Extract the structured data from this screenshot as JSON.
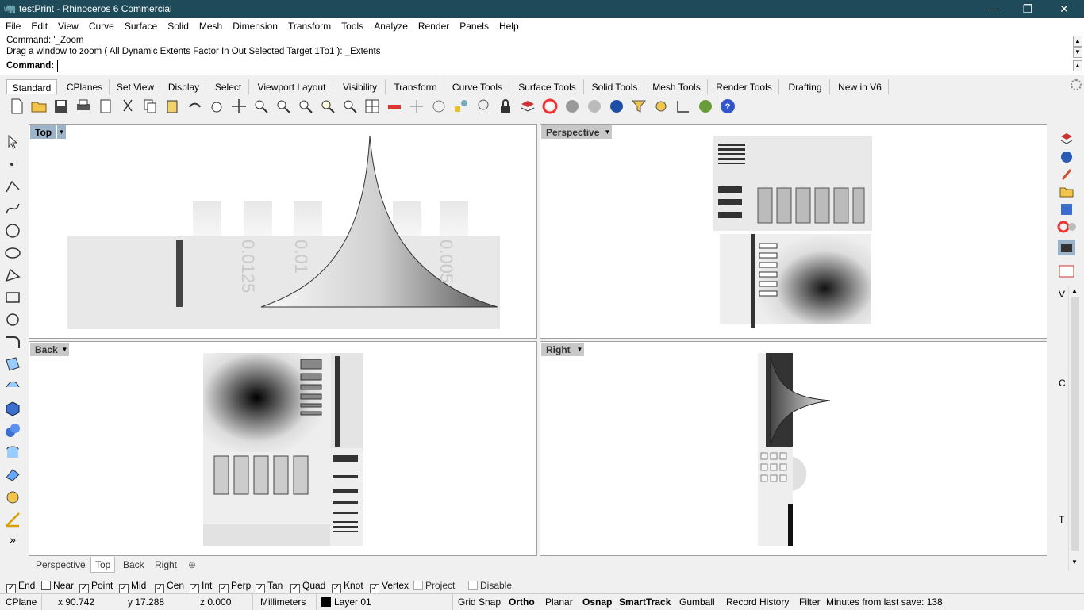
{
  "window": {
    "title": "testPrint - Rhinoceros 6 Commercial",
    "minimize": "—",
    "maximize": "❐",
    "close": "✕"
  },
  "menu": [
    "File",
    "Edit",
    "View",
    "Curve",
    "Surface",
    "Solid",
    "Mesh",
    "Dimension",
    "Transform",
    "Tools",
    "Analyze",
    "Render",
    "Panels",
    "Help"
  ],
  "command": {
    "history1": "Command: '_Zoom",
    "history2": "Drag a window to zoom ( All  Dynamic  Extents  Factor  In  Out  Selected  Target  1To1 ): _Extents",
    "label": "Command:",
    "value": ""
  },
  "toolbar_tabs": [
    "Standard",
    "CPlanes",
    "Set View",
    "Display",
    "Select",
    "Viewport Layout",
    "Visibility",
    "Transform",
    "Curve Tools",
    "Surface Tools",
    "Solid Tools",
    "Mesh Tools",
    "Render Tools",
    "Drafting",
    "New in V6"
  ],
  "viewports": {
    "top": "Top",
    "perspective": "Perspective",
    "back": "Back",
    "right": "Right"
  },
  "top_vp_text": [
    "0.0125",
    "0.01",
    "0.005"
  ],
  "viewport_tabs": [
    "Perspective",
    "Top",
    "Back",
    "Right"
  ],
  "viewport_tab_add": "⊕",
  "osnaps": [
    {
      "label": "End",
      "checked": true
    },
    {
      "label": "Near",
      "checked": false
    },
    {
      "label": "Point",
      "checked": true
    },
    {
      "label": "Mid",
      "checked": true
    },
    {
      "label": "Cen",
      "checked": true
    },
    {
      "label": "Int",
      "checked": true
    },
    {
      "label": "Perp",
      "checked": true
    },
    {
      "label": "Tan",
      "checked": true
    },
    {
      "label": "Quad",
      "checked": true
    },
    {
      "label": "Knot",
      "checked": true
    },
    {
      "label": "Vertex",
      "checked": true
    },
    {
      "label": "Project",
      "checked": false
    },
    {
      "label": "Disable",
      "checked": false
    }
  ],
  "status": {
    "cplane": "CPlane",
    "x": "x 90.742",
    "y": "y 17.288",
    "z": "z 0.000",
    "units": "Millimeters",
    "layer": "Layer 01",
    "grid_snap": "Grid Snap",
    "ortho": "Ortho",
    "planar": "Planar",
    "osnap": "Osnap",
    "smarttrack": "SmartTrack",
    "gumball": "Gumball",
    "record_history": "Record History",
    "filter": "Filter",
    "minutes": "Minutes from last save: 138"
  },
  "right_panel_glyphs": [
    "V",
    "C",
    "T"
  ],
  "left_more": "»",
  "colors": {
    "titlebar": "#1e4a5a",
    "active_vp_label": "#9db3c8",
    "layer_swatch": "#000000"
  }
}
